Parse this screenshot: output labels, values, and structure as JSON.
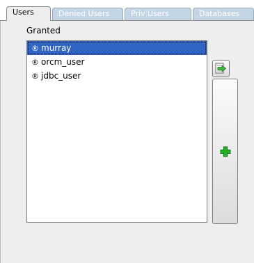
{
  "tabs": [
    {
      "label": "Users",
      "active": true
    },
    {
      "label": "Denied Users",
      "active": false
    },
    {
      "label": "Priv Users",
      "active": false
    },
    {
      "label": "Databases",
      "active": false
    }
  ],
  "granted": {
    "label": "Granted",
    "items": [
      {
        "label": "murray",
        "selected": true
      },
      {
        "label": "orcm_user",
        "selected": false
      },
      {
        "label": "jdbc_user",
        "selected": false
      }
    ]
  },
  "icons": {
    "item_marker": "®",
    "export_button": "export-arrow-icon",
    "add_button": "green-plus-icon"
  },
  "colors": {
    "selection": "#3165c5",
    "inactive_tab": "#c4d6e6",
    "add_icon": "#22b322"
  }
}
